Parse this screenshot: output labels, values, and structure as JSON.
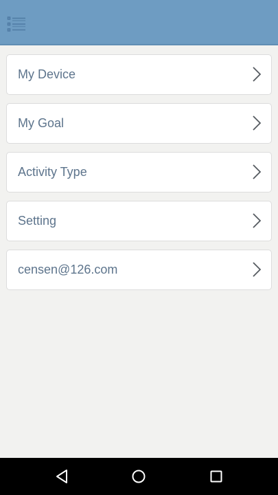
{
  "header": {
    "menu_icon": "list-menu-icon",
    "background_color": "#6e9cc2"
  },
  "menu": {
    "items": [
      {
        "label": "My Device",
        "icon": "chevron-right-icon"
      },
      {
        "label": "My Goal",
        "icon": "chevron-right-icon"
      },
      {
        "label": "Activity Type",
        "icon": "chevron-right-icon"
      },
      {
        "label": "Setting",
        "icon": "chevron-right-icon"
      },
      {
        "label": "censen@126.com",
        "icon": "chevron-right-icon"
      }
    ]
  },
  "system_nav": {
    "back_icon": "back-triangle-icon",
    "home_icon": "home-circle-icon",
    "recents_icon": "recents-square-icon"
  }
}
